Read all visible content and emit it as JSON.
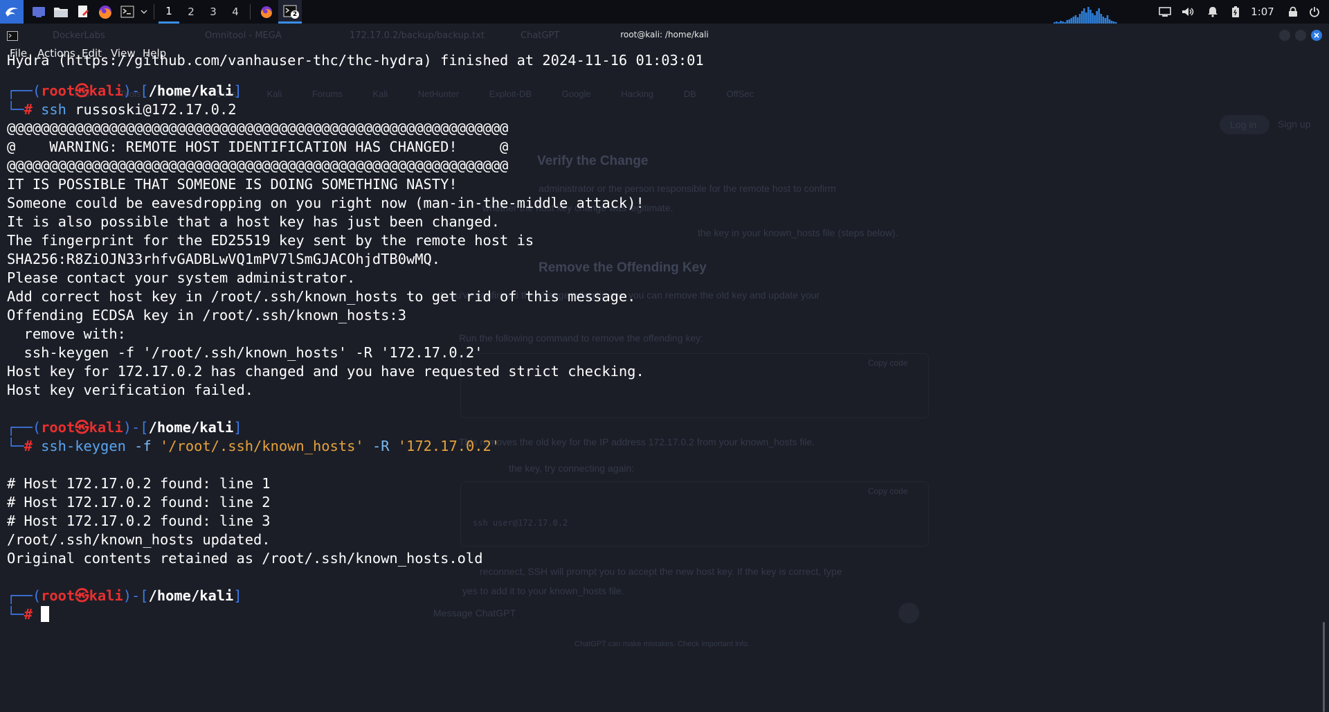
{
  "panel": {
    "workspaces": [
      "1",
      "2",
      "3",
      "4"
    ],
    "active_workspace": "1",
    "terminal_badge": "2",
    "clock": "1:07",
    "accent": "#3a8ee6"
  },
  "window": {
    "title": "root@kali: /home/kali",
    "menu": [
      "File",
      "Actions",
      "Edit",
      "View",
      "Help"
    ]
  },
  "background_window": {
    "tabs": [
      "DockerLabs",
      "Omnitool - MEGA",
      "172.17.0.2/backup/backup.txt",
      "ChatGPT"
    ],
    "bookmarks": [
      "Kali Tools",
      "Kali Docs",
      "Kali Forums",
      "Kali NetHunter",
      "Exploit-DB",
      "Google Hacking DB",
      "OffSec"
    ],
    "buttons": [
      "Log in",
      "Sign up"
    ],
    "heading_1": "Verify the Change",
    "heading_2": "Remove the Offending Key",
    "text_1": "administrator or the person responsible for the remote host to confirm",
    "text_2": "whether the host key change was legitimate.",
    "text_3": "the key in your known_hosts file (steps below).",
    "text_4": "If you've confirmed the change is legitimate, you can remove the old key and update your",
    "text_5": "Run the following command to remove the offending key:",
    "text_6": "This removes the old key for the IP address 172.17.0.2 from your known_hosts file.",
    "text_7": "the key, try connecting again:",
    "code_2": "ssh user@172.17.0.2",
    "text_8": "reconnect, SSH will prompt you to accept the new host key. If the key is correct, type",
    "text_9": "yes to add it to your known_hosts file.",
    "copy_label": "Copy code",
    "message_placeholder": "Message ChatGPT",
    "footer": "ChatGPT can make mistakes. Check important info."
  },
  "terminal": {
    "prompt": {
      "user": "root",
      "at": "㉿",
      "host": "kali",
      "cwd": "/home/kali"
    },
    "line_hydra": "Hydra (https://github.com/vanhauser-thc/thc-hydra) finished at 2024-11-16 01:03:01",
    "cmd1": {
      "command": "ssh",
      "args": "russoski@172.17.0.2"
    },
    "ssh_output": [
      "@@@@@@@@@@@@@@@@@@@@@@@@@@@@@@@@@@@@@@@@@@@@@@@@@@@@@@@@@@@",
      "@    WARNING: REMOTE HOST IDENTIFICATION HAS CHANGED!     @",
      "@@@@@@@@@@@@@@@@@@@@@@@@@@@@@@@@@@@@@@@@@@@@@@@@@@@@@@@@@@@",
      "IT IS POSSIBLE THAT SOMEONE IS DOING SOMETHING NASTY!",
      "Someone could be eavesdropping on you right now (man-in-the-middle attack)!",
      "It is also possible that a host key has just been changed.",
      "The fingerprint for the ED25519 key sent by the remote host is",
      "SHA256:R8ZiOJN33rhfvGADBLwVQ1mPV7lSmGJACOhjdTB0wMQ.",
      "Please contact your system administrator.",
      "Add correct host key in /root/.ssh/known_hosts to get rid of this message.",
      "Offending ECDSA key in /root/.ssh/known_hosts:3",
      "  remove with:",
      "  ssh-keygen -f '/root/.ssh/known_hosts' -R '172.17.0.2'",
      "Host key for 172.17.0.2 has changed and you have requested strict checking.",
      "Host key verification failed."
    ],
    "cmd2": {
      "command": "ssh-keygen",
      "flag_f": "-f",
      "file": "'/root/.ssh/known_hosts'",
      "flag_r": "-R",
      "host": "'172.17.0.2'"
    },
    "keygen_output": [
      "# Host 172.17.0.2 found: line 1",
      "# Host 172.17.0.2 found: line 2",
      "# Host 172.17.0.2 found: line 3",
      "/root/.ssh/known_hosts updated.",
      "Original contents retained as /root/.ssh/known_hosts.old"
    ]
  }
}
